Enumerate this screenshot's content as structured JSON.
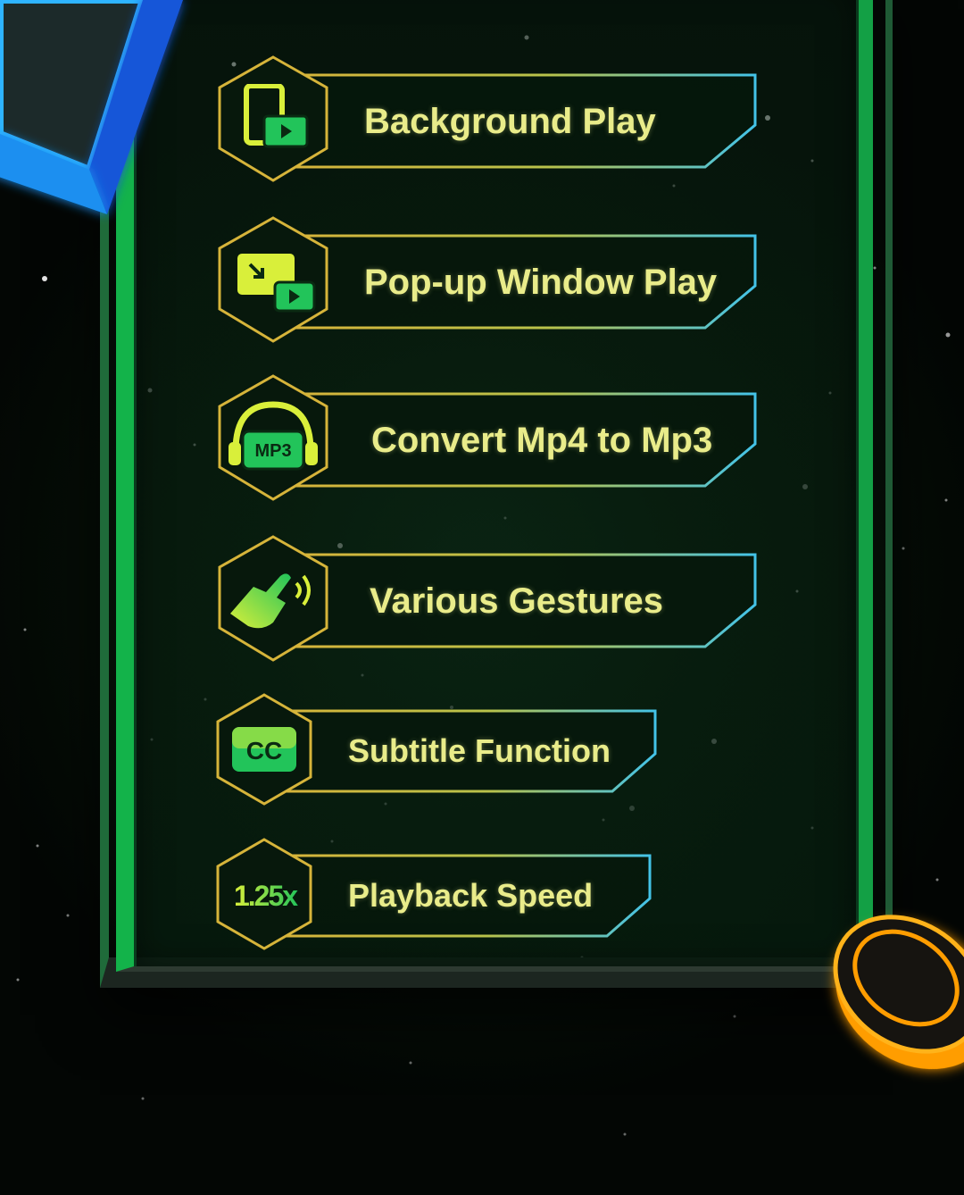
{
  "features": [
    {
      "label": "Background Play",
      "icon": "background-play-icon"
    },
    {
      "label": "Pop-up Window Play",
      "icon": "popup-window-icon"
    },
    {
      "label": "Convert Mp4 to Mp3",
      "icon": "headphones-mp3-icon",
      "icon_text": "MP3"
    },
    {
      "label": "Various Gestures",
      "icon": "hand-gesture-icon"
    },
    {
      "label": "Subtitle Function",
      "icon": "cc-icon",
      "icon_text": "CC"
    },
    {
      "label": "Playback Speed",
      "icon": "speed-icon",
      "icon_text": "1.25x"
    }
  ],
  "colors": {
    "text": "#e9ec8a",
    "gold": "#d6b43a",
    "cyan": "#43c3e8",
    "icon_green": "#22c45a",
    "icon_yellow": "#d9ef3a",
    "frame_green": "#13b34a",
    "accent_blue": "#3da8ff",
    "accent_orange": "#ff9d00"
  }
}
